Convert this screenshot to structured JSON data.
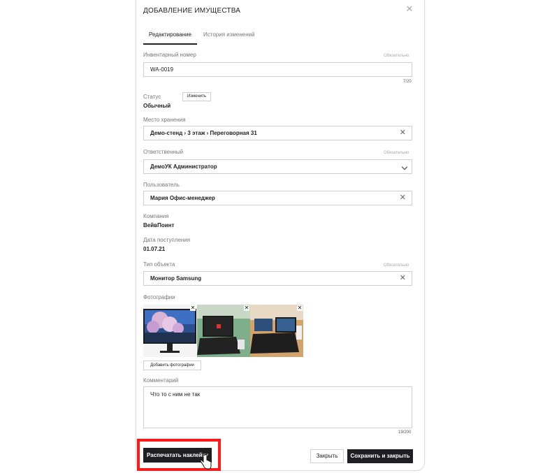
{
  "dialog": {
    "title": "ДОБАВЛЕНИЕ ИМУЩЕСТВА",
    "close_icon": "close-icon"
  },
  "tabs": [
    {
      "label": "Редактирование",
      "active": true
    },
    {
      "label": "История изменений",
      "active": false
    }
  ],
  "required_text": "Обязательно",
  "inventory": {
    "label": "Инвентарный номер",
    "value": "WA-0019",
    "counter": "7/20"
  },
  "status": {
    "label": "Статус",
    "value": "Обычный",
    "change_label": "Изменить"
  },
  "location": {
    "label": "Место хранения",
    "value": "Демо-стенд › 3 этаж › Переговорная 31"
  },
  "responsible": {
    "label": "Ответственный",
    "value": "ДемоУК Администратор"
  },
  "user": {
    "label": "Пользователь",
    "value": "Мария Офис-менеджер"
  },
  "company": {
    "label": "Компания",
    "value": "ВейвПоинт"
  },
  "arrival": {
    "label": "Дата поступления",
    "value": "01.07.21"
  },
  "object_type": {
    "label": "Тип объекта",
    "value": "Монитор Samsung"
  },
  "photos": {
    "label": "Фотографии",
    "items": [
      {
        "name": "monitor-photo"
      },
      {
        "name": "laptop-photo-1"
      },
      {
        "name": "laptop-photo-2"
      }
    ],
    "add_label": "Добавить фотографии"
  },
  "comment": {
    "label": "Комментарий",
    "value": "Что то с ним не так",
    "counter": "19/200"
  },
  "footer": {
    "print_label": "Распечатать наклейку",
    "close_label": "Закрыть",
    "save_label": "Сохранить и закрыть"
  },
  "colors": {
    "primary_button": "#1f1f23",
    "highlight": "#ff1a1a"
  }
}
